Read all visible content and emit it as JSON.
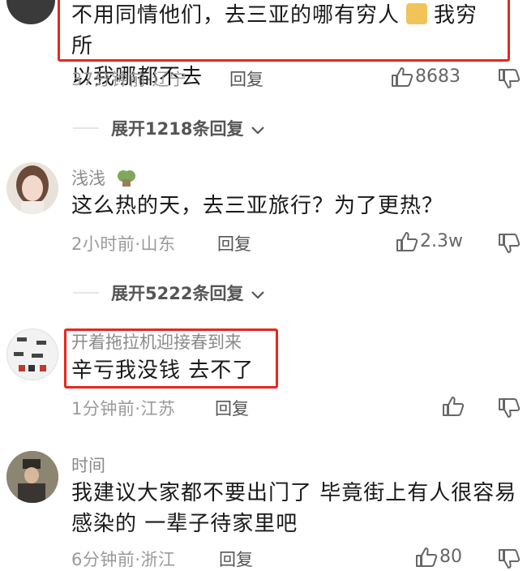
{
  "comments": [
    {
      "text_line1": "不用同情他们，去三亚的哪有穷人",
      "text_line1b": "我穷 所",
      "text_line2": "以我哪都不去",
      "time": "37分钟前·辽宁",
      "reply_label": "回复",
      "likes": "8683"
    },
    {
      "username": "浅浅",
      "text": "这么热的天，去三亚旅行？为了更热？",
      "time": "2小时前·山东",
      "reply_label": "回复",
      "likes": "2.3w"
    },
    {
      "username": "开着拖拉机迎接春到来",
      "text": "辛亏我没钱 去不了",
      "time": "1分钟前·江苏",
      "reply_label": "回复"
    },
    {
      "username": "时间",
      "text_line1": "我建议大家都不要出门了 毕竟街上有人很容易",
      "text_line2": "感染的 一辈子待家里吧",
      "time": "6分钟前·浙江",
      "reply_label": "回复",
      "likes": "80"
    }
  ],
  "expand_rows": [
    {
      "label": "展开1218条回复"
    },
    {
      "label": "展开5222条回复"
    }
  ],
  "colors": {
    "highlight": "#e8261f",
    "meta": "#9a9a9a"
  }
}
